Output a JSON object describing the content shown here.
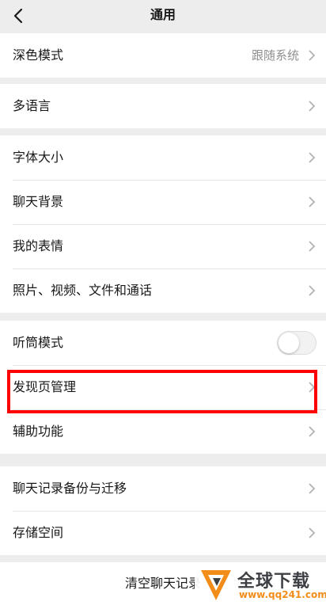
{
  "header": {
    "title": "通用"
  },
  "groups": [
    {
      "items": [
        {
          "label": "深色模式",
          "value": "跟随系统"
        }
      ]
    },
    {
      "items": [
        {
          "label": "多语言"
        }
      ]
    },
    {
      "items": [
        {
          "label": "字体大小"
        },
        {
          "label": "聊天背景"
        },
        {
          "label": "我的表情"
        },
        {
          "label": "照片、视频、文件和通话"
        }
      ]
    },
    {
      "items": [
        {
          "label": "听筒模式",
          "toggle": false
        },
        {
          "label": "发现页管理"
        },
        {
          "label": "辅助功能"
        }
      ]
    },
    {
      "items": [
        {
          "label": "聊天记录备份与迁移"
        },
        {
          "label": "存储空间"
        }
      ]
    }
  ],
  "footer": {
    "clear_label": "清空聊天记录"
  },
  "watermark": {
    "name": "全球下载",
    "url": "www.qq241.com"
  },
  "colors": {
    "background": "#ededed",
    "highlight": "#ff0000",
    "watermark_accent": "#f28d1a"
  }
}
